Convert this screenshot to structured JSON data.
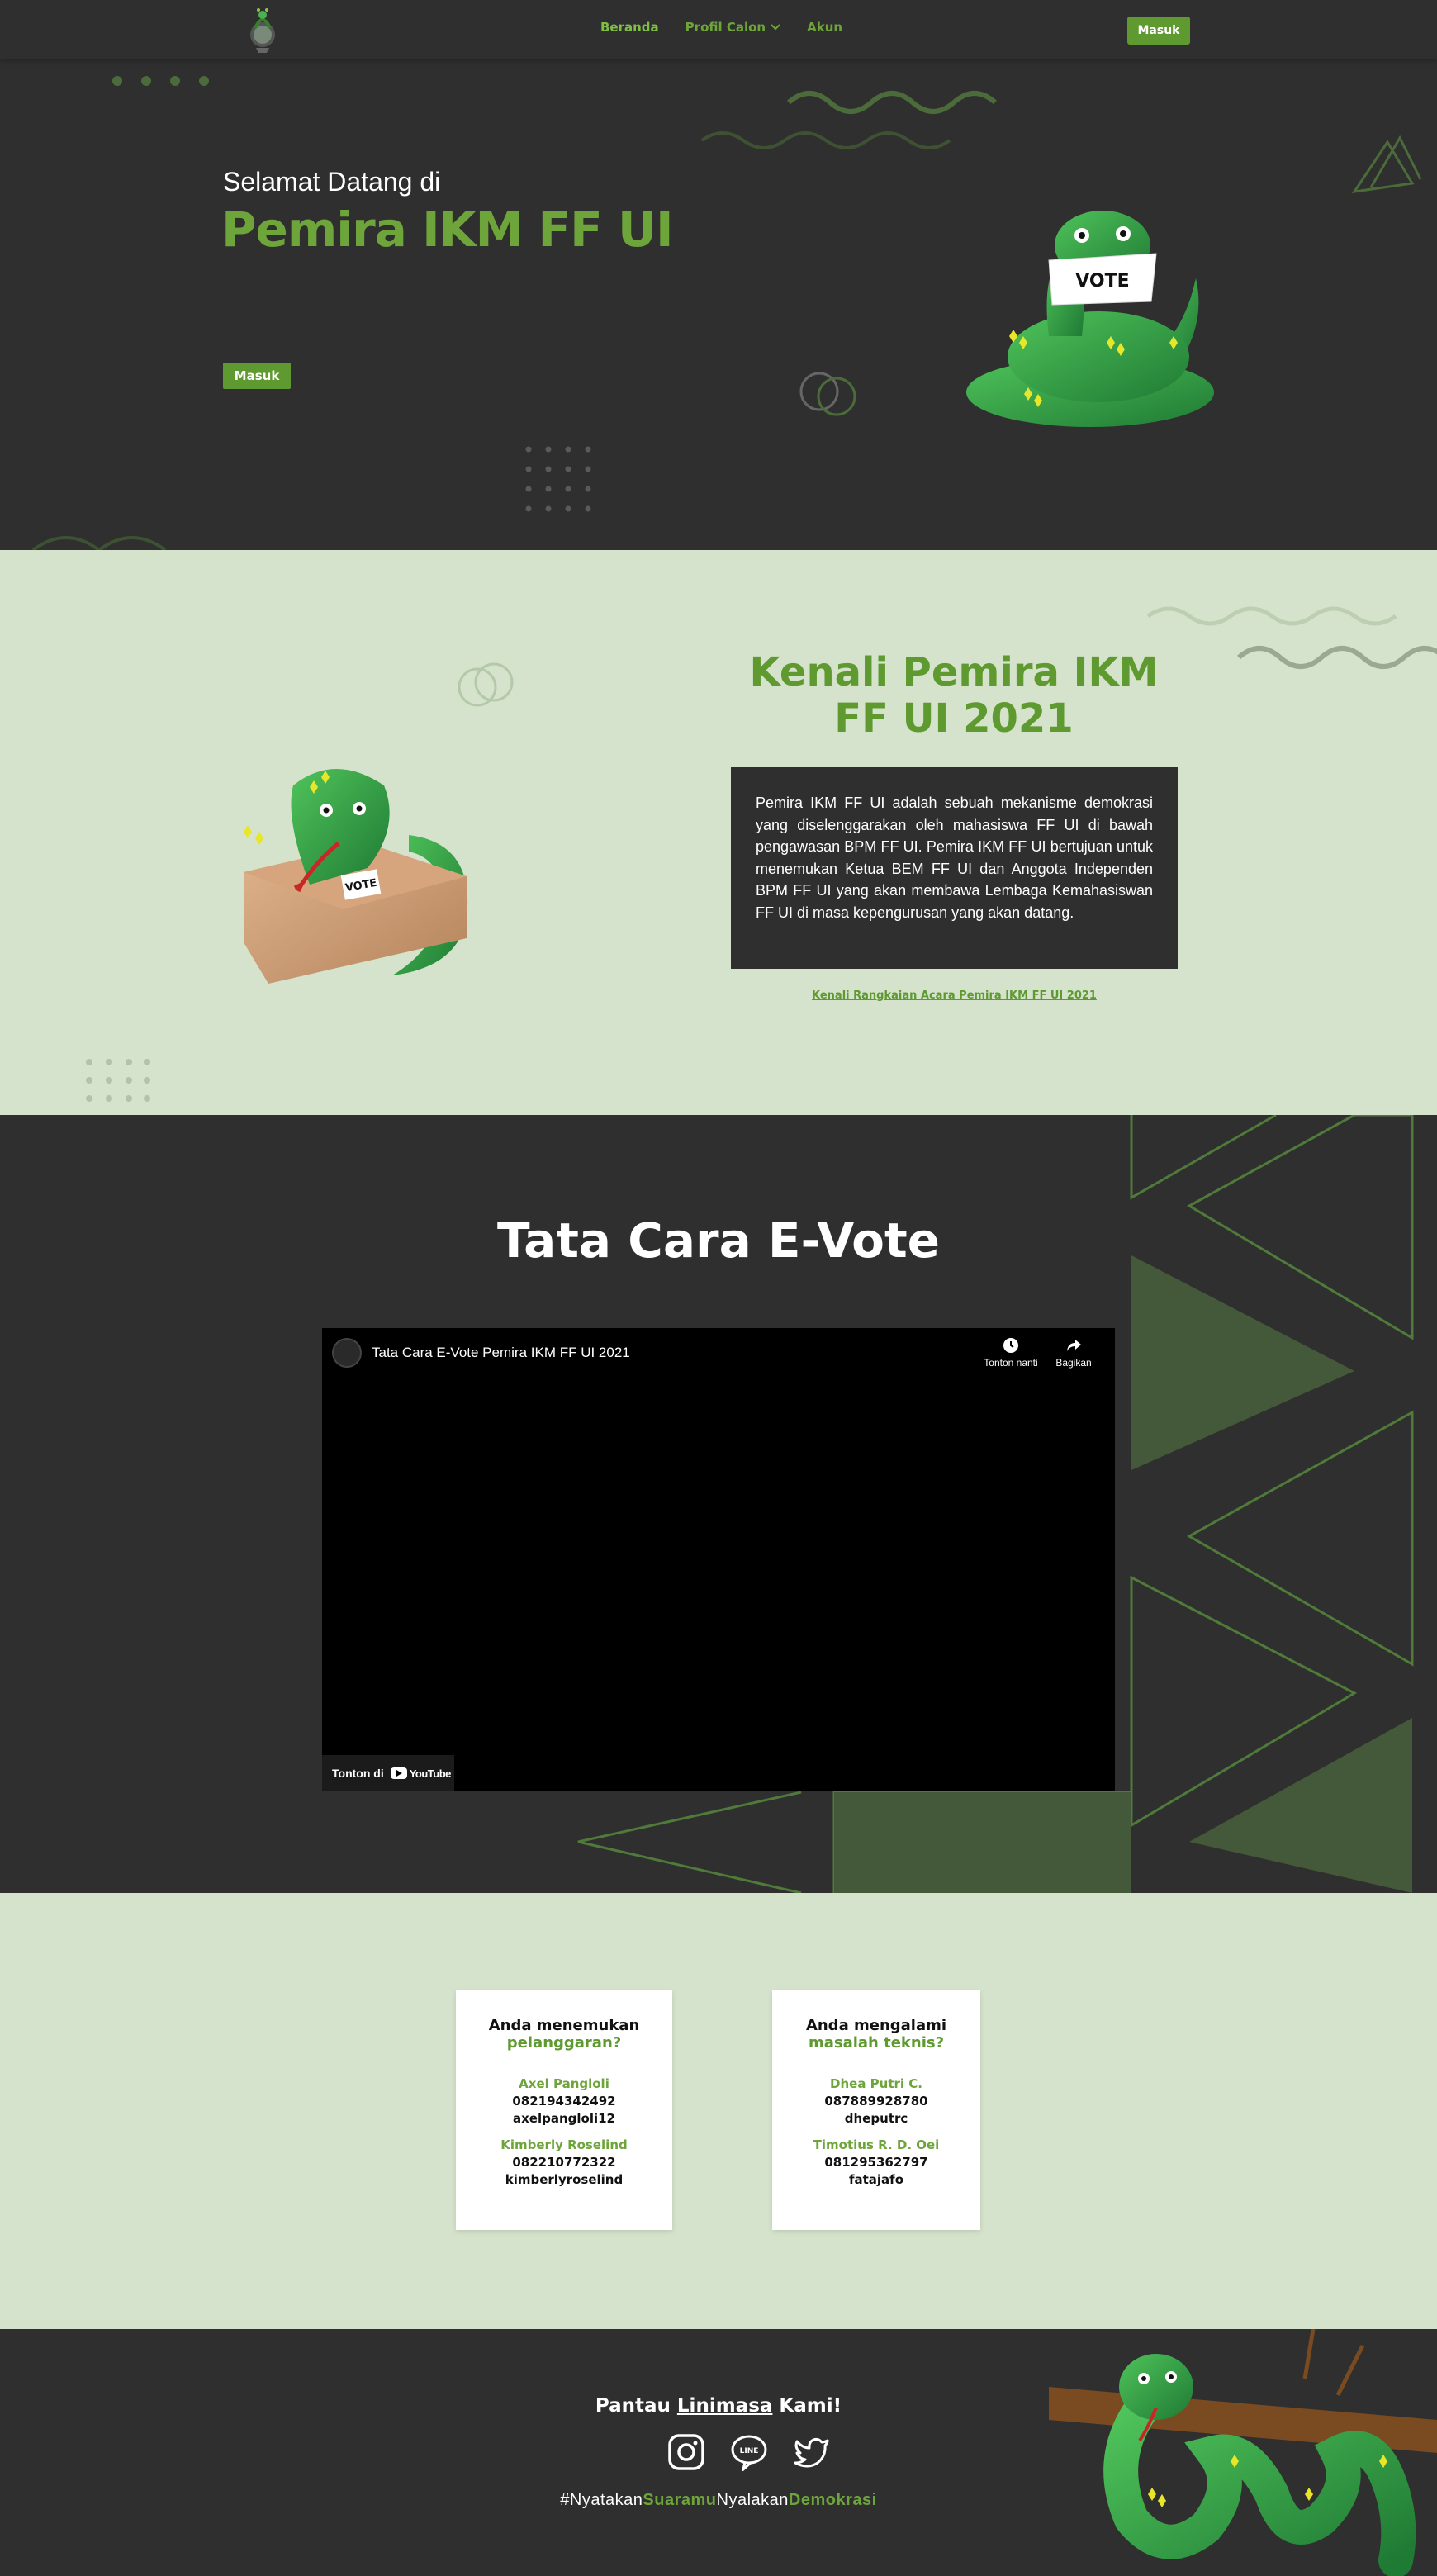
{
  "nav": {
    "links": [
      "Beranda",
      "Profil Calon",
      "Akun"
    ],
    "login": "Masuk"
  },
  "hero": {
    "welcome": "Selamat Datang di",
    "title": "Pemira IKM FF UI",
    "button": "Masuk",
    "sign": "VOTE"
  },
  "about": {
    "title": "Kenali Pemira IKM FF UI 2021",
    "body": "Pemira IKM FF UI adalah sebuah mekanisme demokrasi yang diselenggarakan oleh mahasiswa FF UI di bawah pengawasan BPM FF UI. Pemira IKM FF UI bertujuan untuk menemukan Ketua BEM FF UI dan Anggota Independen BPM FF UI yang akan membawa Lembaga Kemahasiswan FF UI di masa kepengurusan yang akan datang.",
    "link": "Kenali Rangkaian Acara Pemira IKM FF UI 2021",
    "sign": "VOTE"
  },
  "tatacara": {
    "title": "Tata Cara E-Vote",
    "video_title": "Tata Cara E-Vote Pemira IKM FF UI 2021",
    "watch_later": "Tonton nanti",
    "share": "Bagikan",
    "watch_on": "Tonton di",
    "youtube": "YouTube"
  },
  "contact": {
    "cards": [
      {
        "q1": "Anda menemukan",
        "q2": "pelanggaran?",
        "people": [
          {
            "name": "Axel Pangloli",
            "phone": "082194342492",
            "line": "axelpangloli12"
          },
          {
            "name": "Kimberly Roselind",
            "phone": "082210772322",
            "line": "kimberlyroselind"
          }
        ]
      },
      {
        "q1": "Anda mengalami",
        "q2": "masalah teknis?",
        "people": [
          {
            "name": "Dhea Putri C.",
            "phone": "087889928780",
            "line": "dheputrc"
          },
          {
            "name": "Timotius R. D. Oei",
            "phone": "081295362797",
            "line": "fatajafo"
          }
        ]
      }
    ]
  },
  "footer": {
    "title_pre": "Pantau ",
    "title_u": "Linimasa",
    "title_post": " Kami!",
    "line_label": "LINE",
    "hashtag_1": "#Nyatakan",
    "hashtag_2": "Suaramu",
    "hashtag_3": "Nyalakan",
    "hashtag_4": "Demokrasi"
  },
  "colors": {
    "accent": "#6ea53a",
    "dark": "#2f2f2f",
    "light_green": "#d5e3cc"
  }
}
